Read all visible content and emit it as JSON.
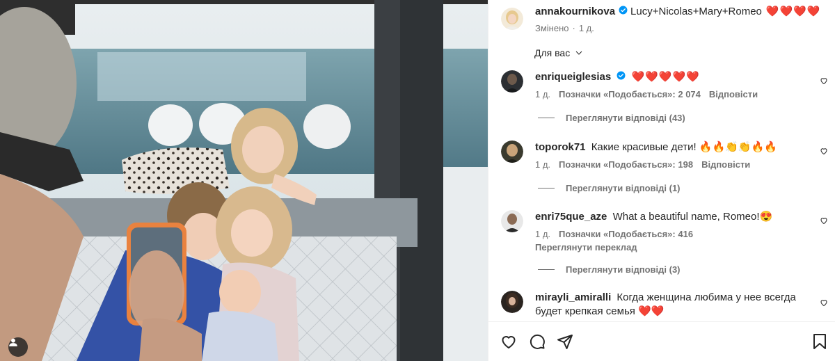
{
  "post": {
    "author": "annakournikova",
    "caption": "Lucy+Nicolas+Mary+Romeo",
    "caption_emoji": "❤️❤️❤️❤️",
    "edited_label": "Змінено",
    "time": "1 д."
  },
  "filter": {
    "label": "Для вас"
  },
  "comments": [
    {
      "username": "enriqueiglesias",
      "verified": true,
      "text": "❤️❤️❤️❤️❤️",
      "time": "1 д.",
      "likes": "Позначки «Подобається»: 2 074",
      "reply_label": "Відповісти",
      "view_replies": "Переглянути відповіді (43)"
    },
    {
      "username": "toporok71",
      "verified": false,
      "text": "Какие красивые дети! 🔥🔥👏👏🔥🔥",
      "time": "1 д.",
      "likes": "Позначки «Подобається»: 198",
      "reply_label": "Відповісти",
      "view_replies": "Переглянути відповіді (1)"
    },
    {
      "username": "enri75que_aze",
      "verified": false,
      "text": "What a beautiful name, Romeo!😍",
      "time": "1 д.",
      "likes": "Позначки «Подобається»: 416",
      "translate_label": "Переглянути переклад",
      "view_replies": "Переглянути відповіді (3)"
    },
    {
      "username": "mirayli_amiralli",
      "verified": false,
      "text_line1": "Когда женщина любима у нее всегда",
      "text_line2": "будет крепкая семья ❤️❤️"
    }
  ],
  "icons": {
    "verified": "verified-badge-icon",
    "like": "heart-outline-icon",
    "comment": "comment-bubble-icon",
    "share": "paper-plane-icon",
    "save": "bookmark-icon",
    "tags": "user-tag-icon",
    "filter": "chevron-down-icon"
  },
  "colors": {
    "verified_blue": "#0095f6",
    "heart_red": "#ed1c24",
    "muted": "#737373"
  }
}
